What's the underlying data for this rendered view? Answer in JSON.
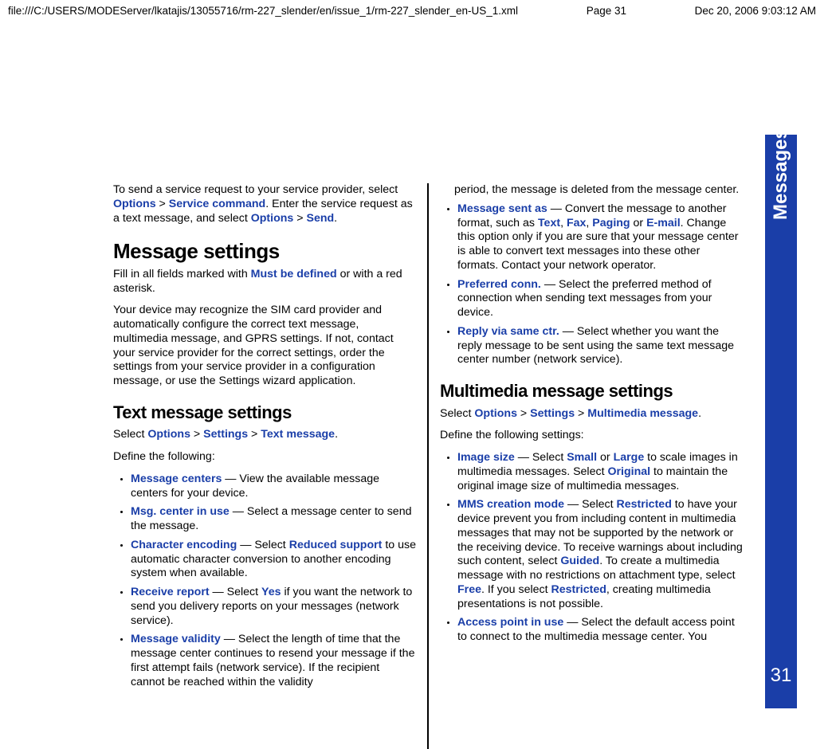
{
  "header": {
    "path": "file:///C:/USERS/MODEServer/lkatajis/13055716/rm-227_slender/en/issue_1/rm-227_slender_en-US_1.xml",
    "page": "Page 31",
    "timestamp": "Dec 20, 2006 9:03:12 AM"
  },
  "sidebar": {
    "label": "Messages",
    "page_no": "31"
  },
  "left": {
    "intro_1": "To send a service request to your service provider, select ",
    "intro_options": "Options",
    "intro_gt1": " > ",
    "intro_sc": "Service command",
    "intro_2": ". Enter the service request as a text message, and select ",
    "intro_options2": "Options",
    "intro_gt2": " > ",
    "intro_send": "Send",
    "intro_3": ".",
    "h1": "Message settings",
    "p1a": "Fill in all fields marked with ",
    "p1b": "Must be defined",
    "p1c": " or with a red asterisk.",
    "p2": "Your device may recognize the SIM card provider and automatically configure the correct text message, multimedia message, and GPRS settings. If not, contact your service provider for the correct settings, order the settings from your service provider in a configuration message, or use the Settings wizard application.",
    "h2": "Text message settings",
    "sel_a": "Select ",
    "sel_opt": "Options",
    "sel_gt1": " > ",
    "sel_set": "Settings",
    "sel_gt2": " > ",
    "sel_txt": "Text message",
    "sel_dot": ".",
    "def": "Define the following:",
    "li1_a": "Message centers",
    "li1_b": " — View the available message centers for your device.",
    "li2_a": "Msg. center in use",
    "li2_b": " — Select a message center to send the message.",
    "li3_a": "Character encoding",
    "li3_b": " — Select ",
    "li3_c": "Reduced support",
    "li3_d": " to use automatic character conversion to another encoding system when available.",
    "li4_a": "Receive report",
    "li4_b": " — Select ",
    "li4_c": "Yes",
    "li4_d": " if you want the network to send you delivery reports on your messages (network service).",
    "li5_a": "Message validity",
    "li5_b": " — Select the length of time that the message center continues to resend your message if the first attempt fails (network service). If the recipient cannot be reached within the validity"
  },
  "right": {
    "cont": "period, the message is deleted from the message center.",
    "li6_a": "Message sent as",
    "li6_b": " — Convert the message to another format, such as ",
    "li6_text": "Text",
    "li6_c1": ", ",
    "li6_fax": "Fax",
    "li6_c2": ", ",
    "li6_pag": "Paging",
    "li6_c3": " or ",
    "li6_email": "E-mail",
    "li6_d": ". Change this option only if you are sure that your message center is able to convert text messages into these other formats. Contact your network operator.",
    "li7_a": "Preferred conn.",
    "li7_b": " — Select the preferred method of connection when sending text messages from your device.",
    "li8_a": "Reply via same ctr.",
    "li8_b": " — Select whether you want the reply message to be sent using the same text message center number (network service).",
    "h2": "Multimedia message settings",
    "sel_a": "Select ",
    "sel_opt": "Options",
    "sel_gt1": " > ",
    "sel_set": "Settings",
    "sel_gt2": " > ",
    "sel_mms": "Multimedia message",
    "sel_dot": ".",
    "def": "Define the following settings:",
    "m1_a": "Image size",
    "m1_b": " — Select ",
    "m1_small": "Small",
    "m1_c": " or ",
    "m1_large": "Large",
    "m1_d": " to scale images in multimedia messages. Select ",
    "m1_orig": "Original",
    "m1_e": " to maintain the original image size of multimedia messages.",
    "m2_a": "MMS creation mode",
    "m2_b": " — Select ",
    "m2_rest": "Restricted",
    "m2_c": " to have your device prevent you from including content in multimedia messages that may not be supported by the network or the receiving device. To receive warnings about including such content, select ",
    "m2_guided": "Guided",
    "m2_d": ". To create a multimedia message with no restrictions on attachment type, select ",
    "m2_free": "Free",
    "m2_e": ". If you select ",
    "m2_rest2": "Restricted",
    "m2_f": ", creating multimedia presentations is not possible.",
    "m3_a": "Access point in use",
    "m3_b": " — Select the default access point to connect to the multimedia message center. You"
  }
}
